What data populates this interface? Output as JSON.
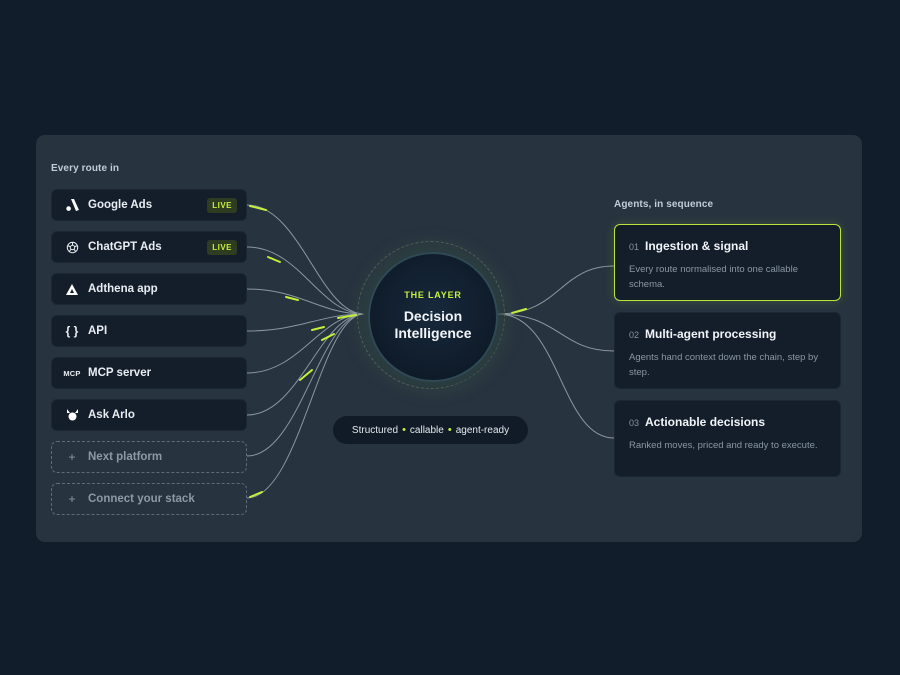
{
  "left": {
    "heading": "Every route in",
    "routes": [
      {
        "label": "Google Ads",
        "badge": "LIVE",
        "icon": "google-ads-icon"
      },
      {
        "label": "ChatGPT Ads",
        "badge": "LIVE",
        "icon": "chatgpt-icon"
      },
      {
        "label": "Adthena app",
        "icon": "adthena-icon"
      },
      {
        "label": "API",
        "icon": "braces-icon",
        "glyph": "{ }"
      },
      {
        "label": "MCP server",
        "icon": "mcp-icon",
        "glyph": "MCP"
      },
      {
        "label": "Ask Arlo",
        "icon": "arlo-icon"
      },
      {
        "label": "Next platform",
        "icon": "plus-icon",
        "glyph": "+"
      },
      {
        "label": "Connect your stack",
        "icon": "plus-icon",
        "glyph": "+"
      }
    ]
  },
  "hub": {
    "kicker": "THE LAYER",
    "title_line1": "Decision",
    "title_line2": "Intelligence"
  },
  "pill": {
    "part1": "Structured",
    "part2": "callable",
    "part3": "agent-ready",
    "separator": "•"
  },
  "right": {
    "heading": "Agents, in sequence",
    "agents": [
      {
        "num": "01",
        "name": "Ingestion & signal",
        "desc": "Every route normalised into one callable schema.",
        "active": true
      },
      {
        "num": "02",
        "name": "Multi-agent processing",
        "desc": "Agents hand context down the chain, step by step."
      },
      {
        "num": "03",
        "name": "Actionable decisions",
        "desc": "Ranked moves, priced and ready to execute."
      }
    ]
  },
  "colors": {
    "background": "#111d2b",
    "panel": "#27333f",
    "card": "#141e2b",
    "accent": "#c5f03a",
    "muted_text": "#8a96a3"
  }
}
